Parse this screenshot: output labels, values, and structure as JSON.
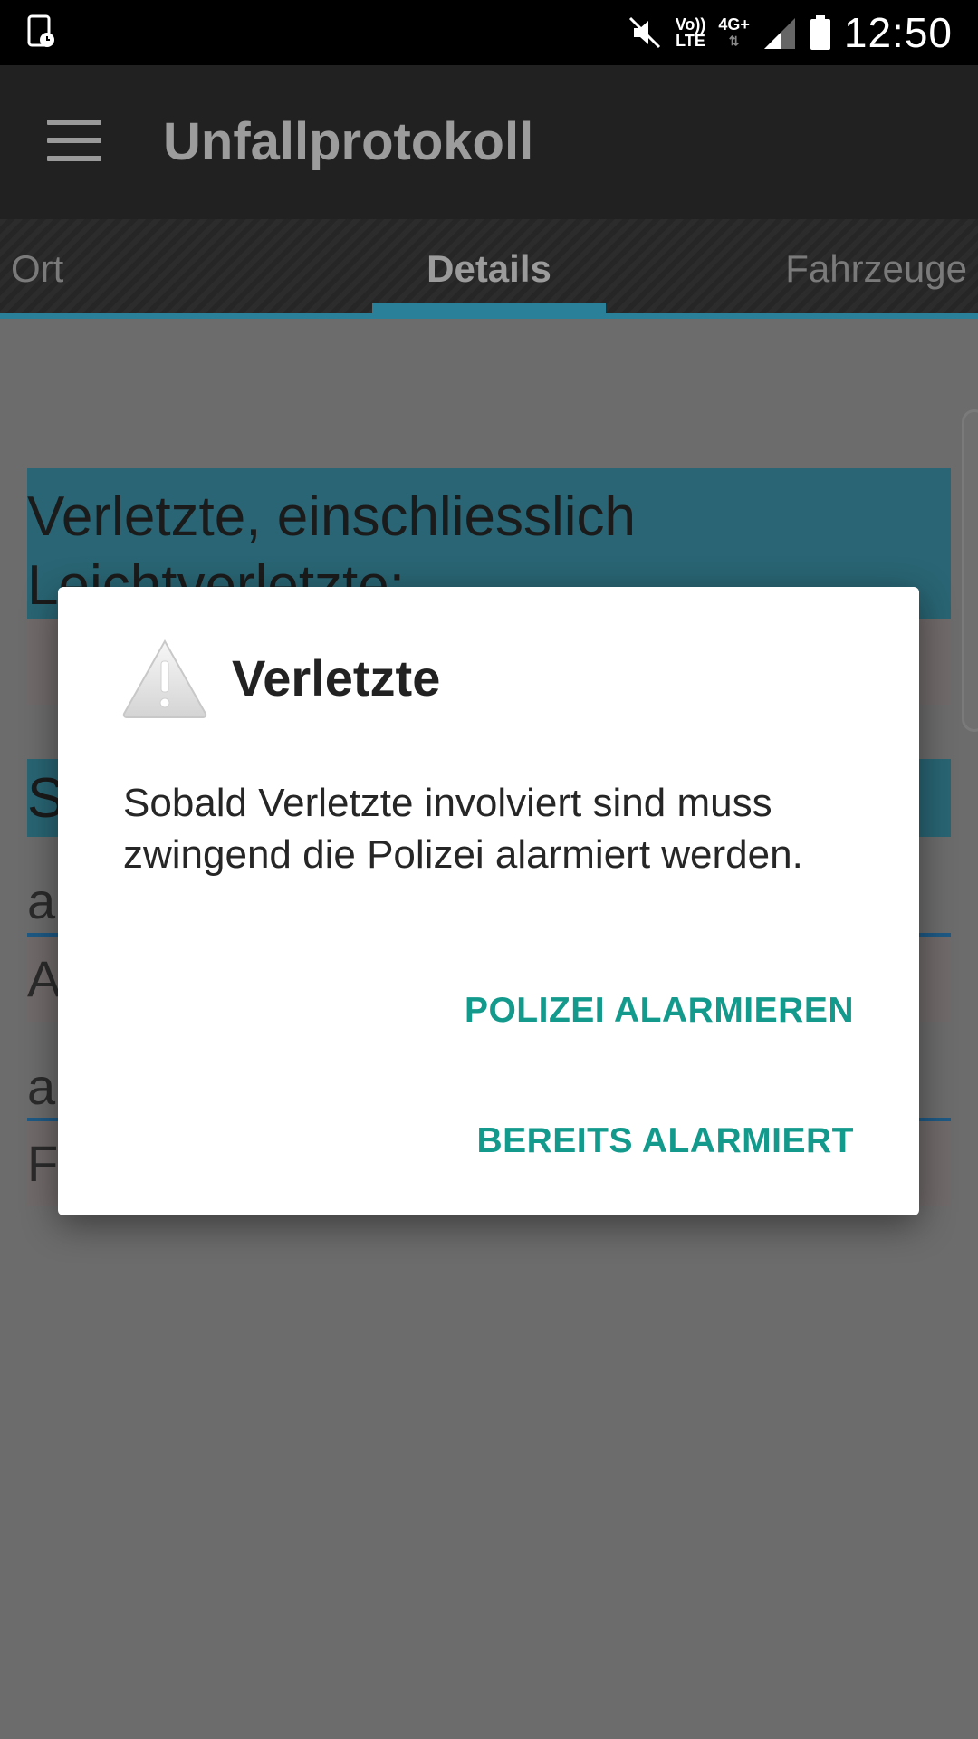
{
  "statusbar": {
    "volte_line1": "Vo))",
    "volte_line2": "LTE",
    "network": "4G+",
    "time": "12:50"
  },
  "appbar": {
    "title": "Unfallprotokoll",
    "menu_icon": "hamburger-menu-icon"
  },
  "tabs": {
    "items": [
      "Ort",
      "Details",
      "Fahrzeuge"
    ],
    "selected": "Details",
    "accent": "#2a7f99"
  },
  "content": {
    "section1_line1": "Verletzte, einschliesslich",
    "section1_line2": "Leichtverletzte:",
    "section2_partial": "S",
    "label1_partial": "a",
    "field1_partial": "A",
    "label2_partial": "a",
    "field2_partial": "F"
  },
  "dialog": {
    "icon": "warning-icon",
    "title": "Verletzte",
    "message": "Sobald Verletzte involviert sind muss zwingend die Polizei alarmiert werden.",
    "button_primary": "POLIZEI ALARMIEREN",
    "button_secondary": "BEREITS ALARMIERT",
    "button_color": "#139a8d"
  }
}
